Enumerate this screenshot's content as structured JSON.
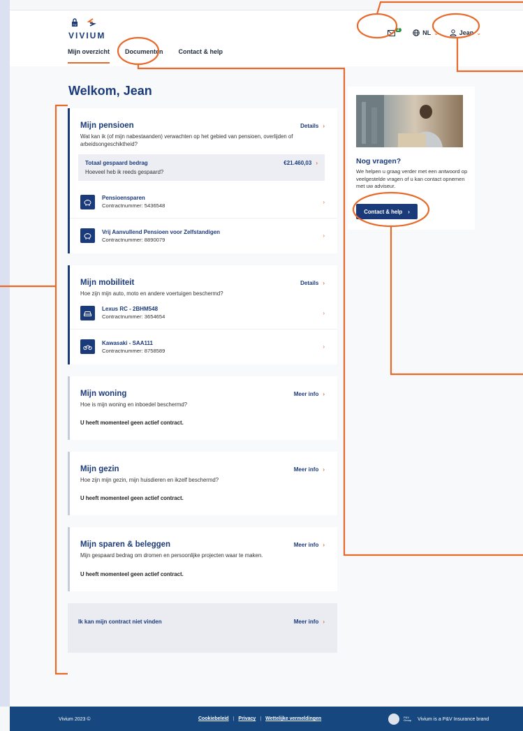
{
  "brand": {
    "name": "VIVIUM"
  },
  "nav": {
    "tabs": [
      "Mijn overzicht",
      "Documenten",
      "Contact & help"
    ]
  },
  "header": {
    "messages_count": "2",
    "language": "NL",
    "user": "Jean"
  },
  "welcome": "Welkom, Jean",
  "pensioen": {
    "title": "Mijn pensioen",
    "link": "Details",
    "sub": "Wat kan ik (of mijn nabestaanden) verwachten op het gebied van pensioen, overlijden of arbeidsongeschiktheid?",
    "total_title": "Totaal gespaard bedrag",
    "total_sub": "Hoeveel heb ik reeds gespaard?",
    "total_amount": "€21.460,03",
    "items": [
      {
        "name": "Pensioensparen",
        "contract": "Contractnummer: 5436548"
      },
      {
        "name": "Vrij Aanvullend Pensioen voor Zelfstandigen",
        "contract": "Contractnummer: 8890079"
      }
    ]
  },
  "mobiliteit": {
    "title": "Mijn mobiliteit",
    "link": "Details",
    "sub": "Hoe zijn mijn auto, moto en andere voertuigen beschermd?",
    "items": [
      {
        "name": "Lexus RC - 2BHM548",
        "contract": "Contractnummer: 3654654"
      },
      {
        "name": "Kawasaki - SAA111",
        "contract": "Contractnummer: 8758589"
      }
    ]
  },
  "woning": {
    "title": "Mijn woning",
    "link": "Meer info",
    "sub": "Hoe is mijn woning en inboedel beschermd?",
    "empty": "U heeft momenteel geen actief contract."
  },
  "gezin": {
    "title": "Mijn gezin",
    "link": "Meer info",
    "sub": "Hoe zijn mijn gezin, mijn huisdieren en ikzelf beschermd?",
    "empty": "U heeft momenteel geen actief contract."
  },
  "sparen": {
    "title": "Mijn sparen & beleggen",
    "link": "Meer info",
    "sub": "Mijn gespaard bedrag om dromen en persoonlijke projecten waar te maken.",
    "empty": "U heeft momenteel geen actief contract."
  },
  "notfound": {
    "title": "Ik kan mijn contract niet vinden",
    "link": "Meer info"
  },
  "side": {
    "question": "Nog vragen?",
    "text": "We helpen u graag verder met een antwoord op veelgestelde vragen of u kan contact opnemen met uw adviseur.",
    "button": "Contact & help"
  },
  "footer": {
    "copyright": "Vivium 2023 ©",
    "links": [
      "Cookiebeleid",
      "Privacy",
      "Wettelijke vermeldingen"
    ],
    "brand_text": "Vivium is a P&V Insurance brand",
    "brand_mark": "P&V Group"
  },
  "colors": {
    "primary": "#1b3a7a",
    "accent": "#e8692a",
    "badge": "#2e8b3c",
    "footer": "#17477f"
  }
}
